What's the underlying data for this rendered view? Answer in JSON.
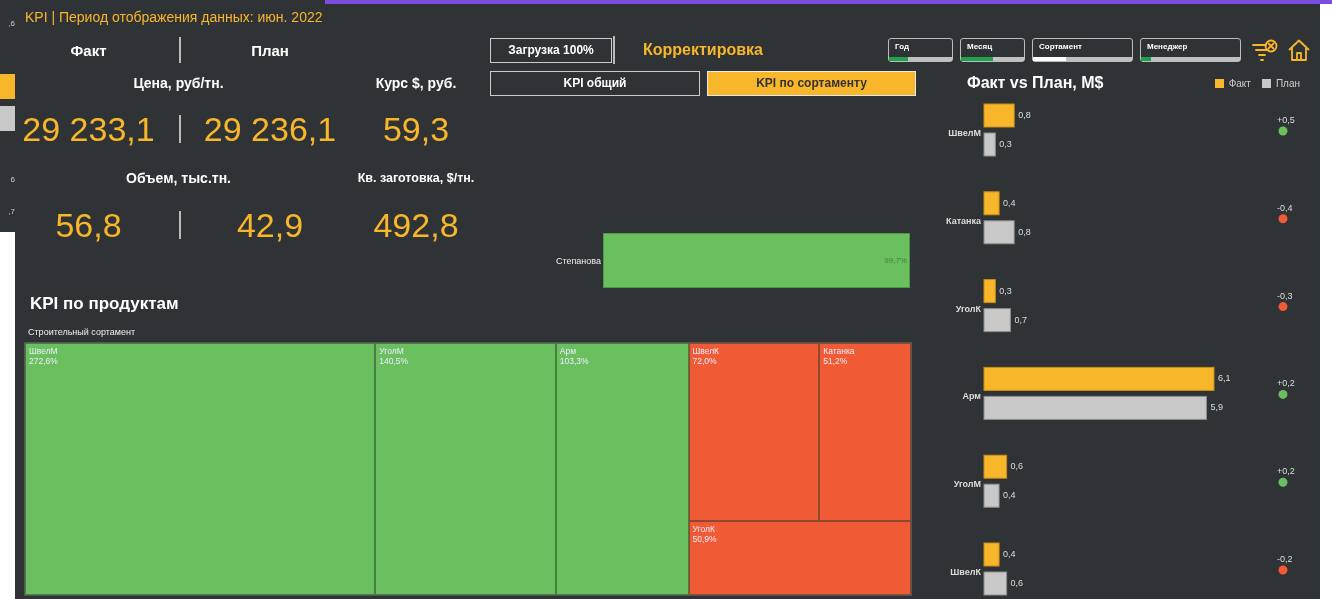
{
  "background_window": {
    "fragments": [
      ",6",
      "6",
      ",7"
    ]
  },
  "header": {
    "title": "KPI | Период отображения данных: июн. 2022"
  },
  "kpi": {
    "columns": [
      "Факт",
      "План"
    ],
    "metrics": [
      {
        "label": "Цена, руб/тн.",
        "fact": "29 233,1",
        "plan": "29 236,1"
      },
      {
        "label": "Объем, тыс.тн.",
        "fact": "56,8",
        "plan": "42,9"
      }
    ],
    "extra": [
      {
        "label": "Курс $, руб.",
        "value": "59,3"
      },
      {
        "label": "Кв. заготовка, $/тн.",
        "value": "492,8"
      }
    ]
  },
  "load_button": "Загрузка 100%",
  "mode_title": "Корректировка",
  "tabs": [
    {
      "label": "KPI общий",
      "selected": false
    },
    {
      "label": "KPI по сортаменту",
      "selected": true
    }
  ],
  "filters": [
    {
      "label": "Год",
      "kind": "selected",
      "level": 0.3
    },
    {
      "label": "Месяц",
      "kind": "selected",
      "level": 0.5
    },
    {
      "label": "Сортамент",
      "kind": "possible",
      "level": 0.33
    },
    {
      "label": "Менеджер",
      "kind": "selected",
      "level": 0.1
    }
  ],
  "manager_kpi": [
    {
      "name": "Степанова",
      "value": "99,7%"
    }
  ],
  "products": {
    "title": "KPI по продуктам",
    "group": "Строительный сортамент",
    "tiles": [
      {
        "name": "ШвелМ",
        "value": "272,6%",
        "color": "#6abf5e"
      },
      {
        "name": "УголМ",
        "value": "140,5%",
        "color": "#6abf5e"
      },
      {
        "name": "Арм",
        "value": "103,3%",
        "color": "#6abf5e"
      },
      {
        "name": "ШвелК",
        "value": "72,0%",
        "color": "#f05a35"
      },
      {
        "name": "Катанка",
        "value": "51,2%",
        "color": "#f05a35"
      },
      {
        "name": "УголК",
        "value": "50,9%",
        "color": "#f05a35"
      }
    ]
  },
  "fact_vs_plan": {
    "title": "Факт vs План, М$",
    "chart_data": {
      "type": "bar",
      "orientation": "horizontal",
      "categories": [
        "ШвелМ",
        "Катанка",
        "УголК",
        "Арм",
        "УголМ",
        "ШвелК"
      ],
      "series": [
        {
          "name": "Факт",
          "color": "#f8b62b",
          "values": [
            0.8,
            0.4,
            0.3,
            6.1,
            0.6,
            0.4
          ],
          "value_labels": [
            "0,8",
            "0,4",
            "0,3",
            "6,1",
            "0,6",
            "0,4"
          ]
        },
        {
          "name": "План",
          "color": "#c8c8c8",
          "values": [
            0.3,
            0.8,
            0.7,
            5.9,
            0.4,
            0.6
          ],
          "value_labels": [
            "0,3",
            "0,8",
            "0,7",
            "5,9",
            "0,4",
            "0,6"
          ]
        }
      ]
    },
    "deltas": [
      {
        "text": "+0,5",
        "color": "#6abf5e"
      },
      {
        "text": "-0,4",
        "color": "#f05a35"
      },
      {
        "text": "-0,3",
        "color": "#f05a35"
      },
      {
        "text": "+0,2",
        "color": "#6abf5e"
      },
      {
        "text": "+0,2",
        "color": "#6abf5e"
      },
      {
        "text": "-0,2",
        "color": "#f05a35"
      }
    ]
  }
}
